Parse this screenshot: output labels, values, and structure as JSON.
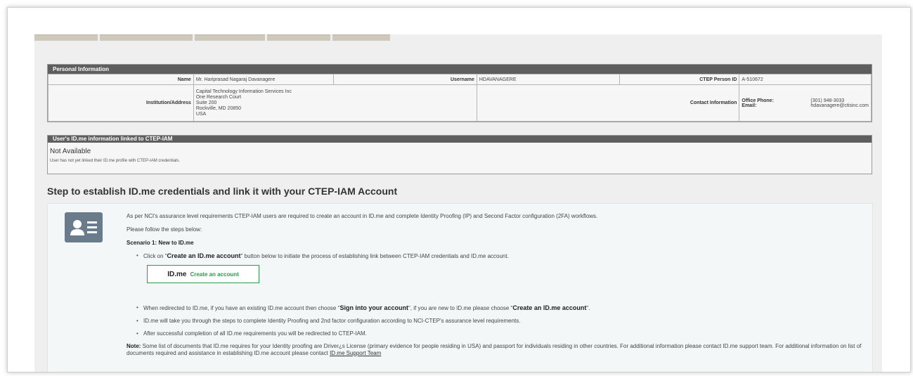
{
  "personal": {
    "header": "Personal Information",
    "name_label": "Name",
    "name_value": "Mr. Hariprasad Nagaraj Davanagere",
    "username_label": "Username",
    "username_value": "HDAVANAGERE",
    "person_id_label": "CTEP Person ID",
    "person_id_value": "A-510672",
    "address_label": "Institution/Address",
    "address_lines": [
      "Capital Technology Information Services Inc",
      "One Research Court",
      "Suite 200",
      "Rockville, MD  20850",
      "USA"
    ],
    "contact_label": "Contact Information",
    "office_phone_label": "Office Phone:",
    "office_phone_value": "(301) 948-3033",
    "email_label": "Email:",
    "email_value": "hdavanagere@ctisinc.com"
  },
  "idme_info": {
    "header": "User's ID.me information linked to CTEP-IAM",
    "status": "Not Available",
    "description": "User has not yet linked their ID.me profile with CTEP-IAM credentials."
  },
  "steps": {
    "title": "Step to establish ID.me credentials and link it with your CTEP-IAM Account",
    "intro": "As per NCI's assurance level requirements CTEP-IAM users are required to create an account in ID.me and complete Identity Proofing (IP) and Second Factor configuration (2FA) workflows.",
    "follow": "Please follow the steps below:",
    "scenario": "Scenario 1: New to ID.me",
    "step1_pre": "Click on \"",
    "step1_bold": "Create an ID.me account",
    "step1_post": "\" button below to initiate the process of establishing link between CTEP-IAM credentials and ID.me account.",
    "button_brand": "ID.me",
    "button_label": "Create an account",
    "step2_pre": "When redirected to ID.me, if you have an existing ID.me account then choose \"",
    "step2_bold1": "Sign into your account",
    "step2_mid": "\", if you are new to ID.me please choose \"",
    "step2_bold2": "Create an ID.me account",
    "step2_post": "\".",
    "step3": "ID.me will take you through the steps to complete Identity Proofing and 2nd factor configuration according to NCI-CTEP's assurance level requirements.",
    "step4": "After successful completion of all ID.me requirements you will be redirected to CTEP-IAM.",
    "note_label": "Note:",
    "note_text": " Some list of documents that ID.me requires for your Identity proofing are Driver¿s License (primary evidence for people residing in USA) and passport for individuals residing in other countries. For additional information please contact ID.me support team. For additional information on list of documents required and assistance in establishing ID.me account please contact ",
    "support_link": "ID.me Support Team"
  }
}
